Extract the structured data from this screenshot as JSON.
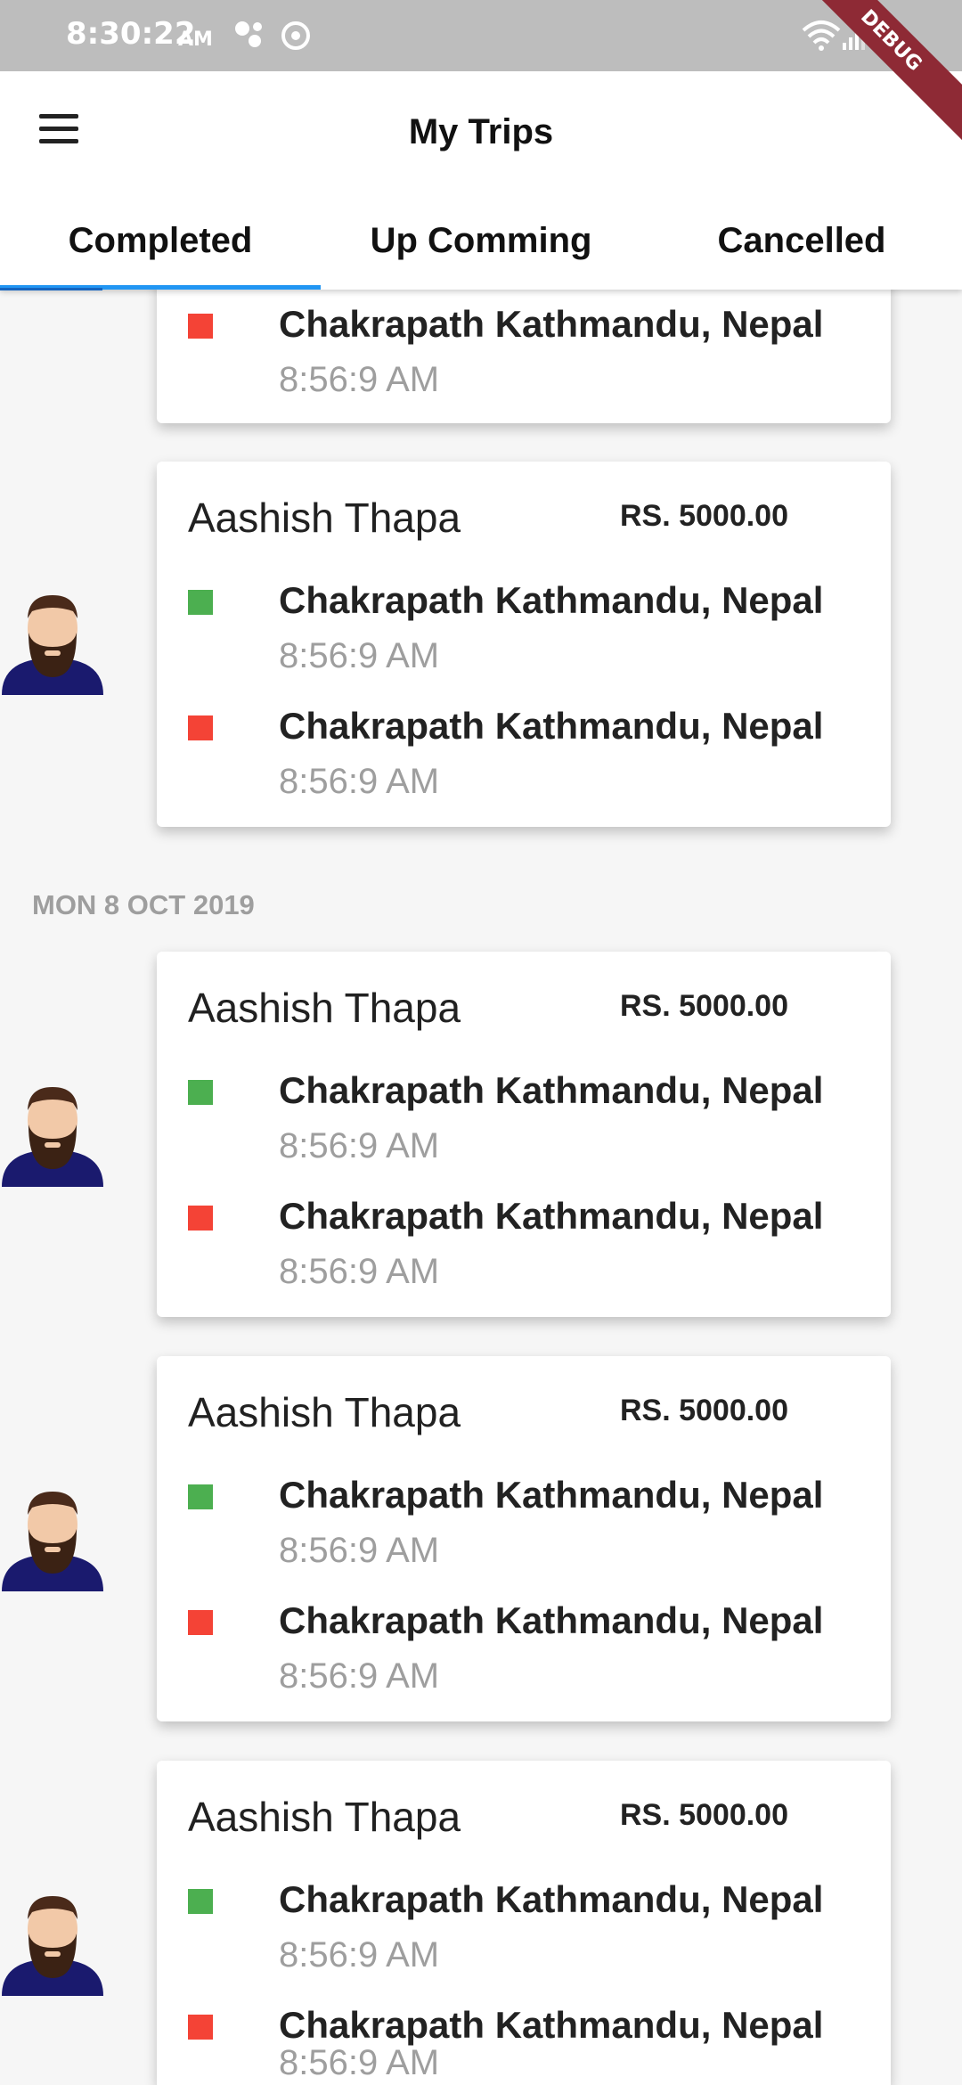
{
  "status_bar": {
    "time": "8:30:22",
    "ampm": "AM",
    "debug_label": "DEBUG"
  },
  "app_bar": {
    "title": "My Trips",
    "menu_icon": "hamburger-menu-icon"
  },
  "tabs": [
    {
      "label": "Completed",
      "selected": true
    },
    {
      "label": "Up Comming",
      "selected": false
    },
    {
      "label": "Cancelled",
      "selected": false
    }
  ],
  "colors": {
    "accent": "#2196f3",
    "pickup": "#4caf50",
    "dropoff": "#f44336"
  },
  "date_headers": [
    "MON 8 OCT 2019"
  ],
  "partial_card": {
    "dropoff": {
      "address": "Chakrapath Kathmandu, Nepal",
      "time": "8:56:9 AM"
    }
  },
  "trips": [
    {
      "name": "Aashish Thapa",
      "fare": "RS. 5000.00",
      "pickup": {
        "address": "Chakrapath Kathmandu, Nepal",
        "time": "8:56:9 AM"
      },
      "dropoff": {
        "address": "Chakrapath Kathmandu, Nepal",
        "time": "8:56:9 AM"
      }
    },
    {
      "name": "Aashish Thapa",
      "fare": "RS. 5000.00",
      "pickup": {
        "address": "Chakrapath Kathmandu, Nepal",
        "time": "8:56:9 AM"
      },
      "dropoff": {
        "address": "Chakrapath Kathmandu, Nepal",
        "time": "8:56:9 AM"
      }
    },
    {
      "name": "Aashish Thapa",
      "fare": "RS. 5000.00",
      "pickup": {
        "address": "Chakrapath Kathmandu, Nepal",
        "time": "8:56:9 AM"
      },
      "dropoff": {
        "address": "Chakrapath Kathmandu, Nepal",
        "time": "8:56:9 AM"
      }
    },
    {
      "name": "Aashish Thapa",
      "fare": "RS. 5000.00",
      "pickup": {
        "address": "Chakrapath Kathmandu, Nepal",
        "time": "8:56:9 AM"
      },
      "dropoff": {
        "address": "Chakrapath Kathmandu, Nepal",
        "time": "8:56:9 AM"
      }
    }
  ]
}
